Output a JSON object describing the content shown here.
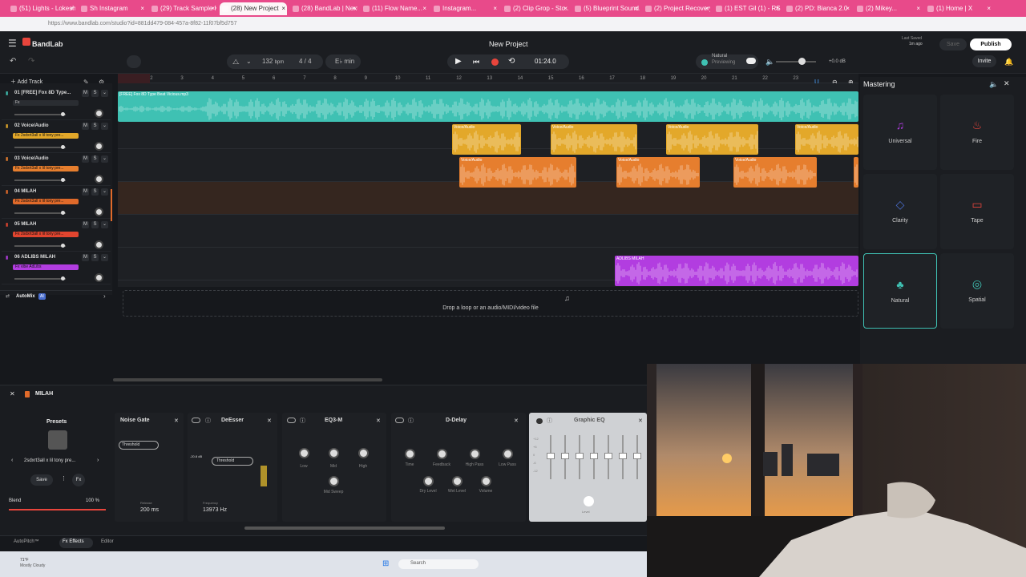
{
  "browser": {
    "tabs": [
      "(51) Lights - Lokesh Y...",
      "Sh Instagram",
      "(29) Track Sample K...",
      "(28) New Project",
      "(28) BandLab | Next Home",
      "(11) Flow Name...",
      "Instagram...",
      "(2) Clip Grop - Sto...",
      "(5) Blueprint Sound...",
      "(2) Project Recovery...",
      "(1) EST Gil (1) - RSS...",
      "(2) PD: Bianca 2.0",
      "(2) Mikey...",
      "(1) Home | X"
    ],
    "active_tab": 3,
    "url": "https://www.bandlab.com/studio?id=881dd479-084-457a-8f82-11f07bf5d757"
  },
  "app": {
    "brand": "BandLab",
    "project_title": "New Project",
    "last_saved_label": "Last Saved",
    "last_saved_value": "1m ago",
    "save_label": "Save",
    "publish_label": "Publish",
    "invite_label": "Invite",
    "bpm_value": "132",
    "bpm_unit": "bpm",
    "time_sig": "4 / 4",
    "key": "E♭ min",
    "time_display": "01:24.0",
    "preview_label_1": "Natural",
    "preview_label_2": "Previewing",
    "volume_db": "+0.0 dB",
    "add_track_label": "Add Track",
    "automix_label": "AutoMix",
    "automix_badge": "AI",
    "drop_text": "Drop a loop or an audio/MIDI/video file"
  },
  "ruler": [
    "1",
    "2",
    "3",
    "4",
    "5",
    "6",
    "7",
    "8",
    "9",
    "10",
    "11",
    "12",
    "13",
    "14",
    "15",
    "16",
    "17",
    "18",
    "19",
    "20",
    "21",
    "22",
    "23"
  ],
  "tracks": [
    {
      "name": "01 [FREE] Fox 8D Type...",
      "fx": "Fx",
      "fx_color": "#2a2d32",
      "color": "#3fc1b3"
    },
    {
      "name": "02 Voice/Audio",
      "fx": "Fx 2sdxrt3all x lil tony pre...",
      "fx_color": "#e3a82a",
      "color": "#e3a82a"
    },
    {
      "name": "03 Voice/Audio",
      "fx": "Fx 2sdxrt3all x lil tony pre...",
      "fx_color": "#e67e2e",
      "color": "#e67e2e"
    },
    {
      "name": "04 MILAH",
      "fx": "Fx 2sdxrt3all x lil tony pre...",
      "fx_color": "#e06a2a",
      "color": "#e06a2a"
    },
    {
      "name": "05 MILAH",
      "fx": "Fx 2sdxrt3all x lil tony pre...",
      "fx_color": "#e2452f",
      "color": "#e2452f"
    },
    {
      "name": "06 ADLIBS MILAH",
      "fx": "Fx vibe AdLibs",
      "fx_color": "#b23de0",
      "color": "#b23de0"
    }
  ],
  "clips": {
    "track1": "[FREE] Fox 8D Type Beat Vicious.mp3",
    "voice": "Voice/Audio",
    "adlibs": "ADLIBS MILAH"
  },
  "mastering": {
    "title": "Mastering",
    "presets": [
      "Universal",
      "Fire",
      "Clarity",
      "Tape",
      "Natural",
      "Spatial"
    ],
    "selected": "Natural"
  },
  "fx": {
    "track_name": "MILAH",
    "presets_label": "Presets",
    "preset_name": "2sdxrt3all x lil tony pre...",
    "save_label": "Save",
    "blend_label": "Blend",
    "blend_value": "100 %",
    "blend_fraction": 1.0,
    "modules": {
      "noise_gate": {
        "title": "Noise Gate",
        "threshold": "Threshold",
        "release_label": "Release",
        "release_value": "200 ms"
      },
      "deesser": {
        "title": "DeEsser",
        "threshold": "Threshold",
        "db_value": "-20.8 dB",
        "freq_label": "Frequency",
        "freq_value": "13973 Hz"
      },
      "eq3": {
        "title": "EQ3-M",
        "knobs": [
          "Low",
          "Mid",
          "High"
        ],
        "extra": "Mid Sweep"
      },
      "delay": {
        "title": "D-Delay",
        "knobs": [
          "Time",
          "Feedback",
          "High Pass",
          "Low Pass"
        ],
        "knobs2": [
          "Dry Level",
          "Wet Level",
          "Volume"
        ]
      },
      "geq": {
        "title": "Graphic EQ",
        "level": "Level",
        "scale": [
          "+12",
          "+6",
          "0",
          "-6",
          "-12"
        ]
      }
    },
    "tabs": [
      "AutoPitch™",
      "Fx Effects",
      "Editor"
    ]
  },
  "taskbar": {
    "weather": "71°F",
    "weather_sub": "Mostly Cloudy",
    "search": "Search"
  }
}
